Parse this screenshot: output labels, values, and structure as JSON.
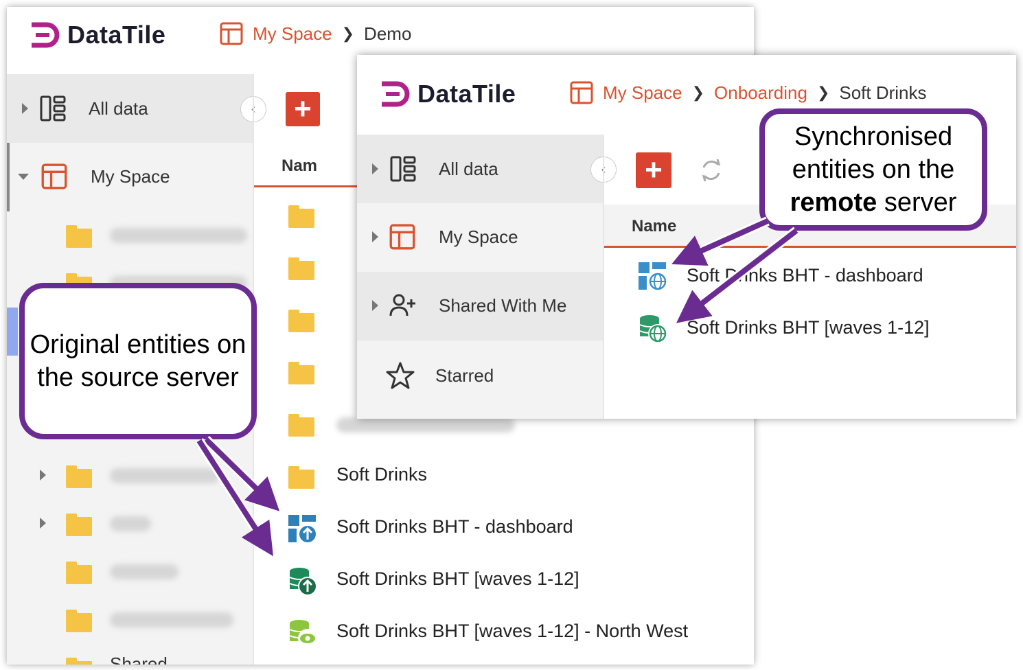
{
  "source_window": {
    "app_name": "DataTile",
    "breadcrumb": {
      "root": "My Space",
      "current": "Demo"
    },
    "sidebar": {
      "all_data": "All data",
      "my_space": "My Space",
      "bottom_partial": "Shared"
    },
    "table": {
      "name_header": "Nam"
    },
    "rows": [
      {
        "label": "Soft Drinks",
        "icon": "folder-icon"
      },
      {
        "label": "Soft Drinks BHT - dashboard",
        "icon": "dashboard-upload-icon"
      },
      {
        "label": "Soft Drinks BHT [waves 1-12]",
        "icon": "database-upload-icon"
      },
      {
        "label": "Soft Drinks BHT [waves 1-12] - North West",
        "icon": "database-view-icon"
      }
    ]
  },
  "remote_window": {
    "app_name": "DataTile",
    "breadcrumb": {
      "root": "My Space",
      "middle": "Onboarding",
      "current": "Soft Drinks"
    },
    "sidebar": {
      "all_data": "All data",
      "my_space": "My Space",
      "shared": "Shared With Me",
      "starred": "Starred"
    },
    "table": {
      "name_header": "Name"
    },
    "rows": [
      {
        "label": "Soft Drinks BHT - dashboard",
        "icon": "dashboard-globe-icon"
      },
      {
        "label": "Soft Drinks BHT [waves 1-12]",
        "icon": "database-globe-icon"
      }
    ]
  },
  "callouts": {
    "source": "Original entities on the source server",
    "remote_line1": "Synchronised",
    "remote_line2": "entities on the",
    "remote_bold": "remote",
    "remote_line3_rest": " server"
  },
  "colors": {
    "accent": "#d9532f",
    "add_button": "#d9432f",
    "folder": "#f6c445",
    "callout_border": "#6a2c91",
    "logo_magenta": "#b0218a"
  }
}
